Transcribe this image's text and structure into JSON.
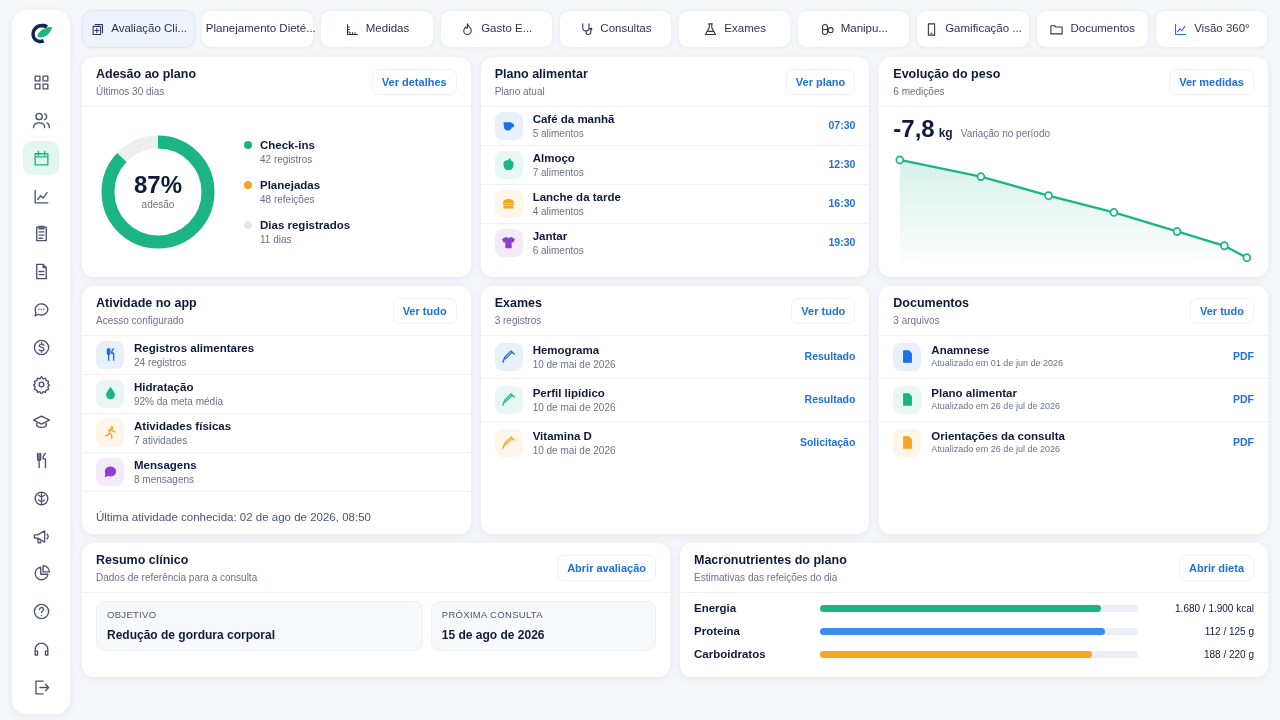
{
  "sidebar": {
    "items": [
      {
        "selected": false
      },
      {
        "selected": false
      },
      {
        "selected": true
      },
      {
        "selected": false
      },
      {
        "selected": false
      },
      {
        "selected": false
      },
      {
        "selected": false
      },
      {
        "selected": false
      },
      {
        "selected": false
      },
      {
        "selected": false
      },
      {
        "selected": false
      },
      {
        "selected": false
      },
      {
        "selected": false
      },
      {
        "selected": false
      },
      {
        "selected": false
      },
      {
        "selected": false
      },
      {
        "selected": false
      }
    ]
  },
  "tabs": [
    {
      "label": "Avaliação Cli...",
      "selected": true
    },
    {
      "label": "Planejamento Dieté...",
      "selected": false
    },
    {
      "label": "Medidas",
      "selected": false
    },
    {
      "label": "Gasto E...",
      "selected": false
    },
    {
      "label": "Consultas",
      "selected": false
    },
    {
      "label": "Exames",
      "selected": false
    },
    {
      "label": "Manipu...",
      "selected": false
    },
    {
      "label": "Gamificação ...",
      "selected": false
    },
    {
      "label": "Documentos",
      "selected": false
    },
    {
      "label": "Visão 360°",
      "selected": false
    }
  ],
  "adherence": {
    "title": "Adesão ao plano",
    "subtitle": "Últimos 30 dias",
    "action": "Ver detalhes",
    "value": "87%",
    "value_label": "adesão",
    "level": 0.87,
    "legend": [
      {
        "label": "Check-ins",
        "detail": "42 registros",
        "color": "#1bb585"
      },
      {
        "label": "Planejadas",
        "detail": "48 refeições",
        "color": "#f5a623"
      },
      {
        "label": "Dias registrados",
        "detail": "11 dias",
        "color": "#e3e6eb"
      }
    ]
  },
  "meal_plan": {
    "title": "Plano alimentar",
    "subtitle": "Plano atual",
    "action": "Ver plano",
    "meals": [
      {
        "name": "Café da manhã",
        "detail": "5 alimentos",
        "time": "07:30",
        "color": "#1f6fe5"
      },
      {
        "name": "Almoço",
        "detail": "7 alimentos",
        "time": "12:30",
        "color": "#1bb585"
      },
      {
        "name": "Lanche da tarde",
        "detail": "4 alimentos",
        "time": "16:30",
        "color": "#f5a623"
      },
      {
        "name": "Jantar",
        "detail": "6 alimentos",
        "time": "19:30",
        "color": "#8e3fd1"
      }
    ]
  },
  "weight": {
    "title": "Evolução do peso",
    "subtitle": "6 medições",
    "action": "Ver medidas",
    "change": "-7,8",
    "unit": "kg",
    "change_label": "Variação no período"
  },
  "app_activity": {
    "title": "Atividade no app",
    "subtitle": "Acesso configurado",
    "action": "Ver tudo",
    "items": [
      {
        "name": "Registros alimentares",
        "detail": "24 registros",
        "color": "#1f6fe5"
      },
      {
        "name": "Hidratação",
        "detail": "92% da meta média",
        "color": "#1bb585"
      },
      {
        "name": "Atividades físicas",
        "detail": "7 atividades",
        "color": "#f5a623"
      },
      {
        "name": "Mensagens",
        "detail": "8 mensagens",
        "color": "#8e3fd1"
      }
    ],
    "footer": "Última atividade conhecida: 02 de ago de 2026, 08:50"
  },
  "exams": {
    "title": "Exames",
    "subtitle": "3 registros",
    "action": "Ver tudo",
    "items": [
      {
        "name": "Hemograma",
        "date": "10 de mai de 2026",
        "action": "Resultado",
        "color": "#1f6fe5"
      },
      {
        "name": "Perfil lipídico",
        "date": "10 de mai de 2026",
        "action": "Resultado",
        "color": "#1bb585"
      },
      {
        "name": "Vitamina D",
        "date": "10 de mai de 2026",
        "action": "Solicitação",
        "color": "#f5a623"
      }
    ]
  },
  "documents": {
    "title": "Documentos",
    "subtitle": "3 arquivos",
    "action": "Ver tudo",
    "items": [
      {
        "name": "Anamnese",
        "updated": "Atualizado em 01 de jun de 2026",
        "action": "PDF",
        "color": "#1f6fe5"
      },
      {
        "name": "Plano alimentar",
        "updated": "Atualizado em 26 de jul de 2026",
        "action": "PDF",
        "color": "#1bb585"
      },
      {
        "name": "Orientações da consulta",
        "updated": "Atualizado em 26 de jul de 2026",
        "action": "PDF",
        "color": "#f5a623"
      }
    ]
  },
  "clinical_summary": {
    "title": "Resumo clínico",
    "subtitle": "Dados de referência para a consulta",
    "action": "Abrir avaliação",
    "fields": [
      {
        "label": "OBJETIVO",
        "value": "Redução de gordura corporal"
      },
      {
        "label": "PRÓXIMA CONSULTA",
        "value": "15 de ago de 2026"
      }
    ]
  },
  "macros": {
    "title": "Macronutrientes do plano",
    "subtitle": "Estimativas das refeições do dia",
    "action": "Abrir dieta",
    "rows": [
      {
        "name": "Energia",
        "reading": "1.680 / 1.900 kcal",
        "level": 0.884,
        "color": "#1bb585"
      },
      {
        "name": "Proteína",
        "reading": "112 / 125 g",
        "level": 0.896,
        "color": "#3b8cf0"
      },
      {
        "name": "Carboidratos",
        "reading": "188 / 220 g",
        "level": 0.855,
        "color": "#f5a623"
      }
    ]
  }
}
